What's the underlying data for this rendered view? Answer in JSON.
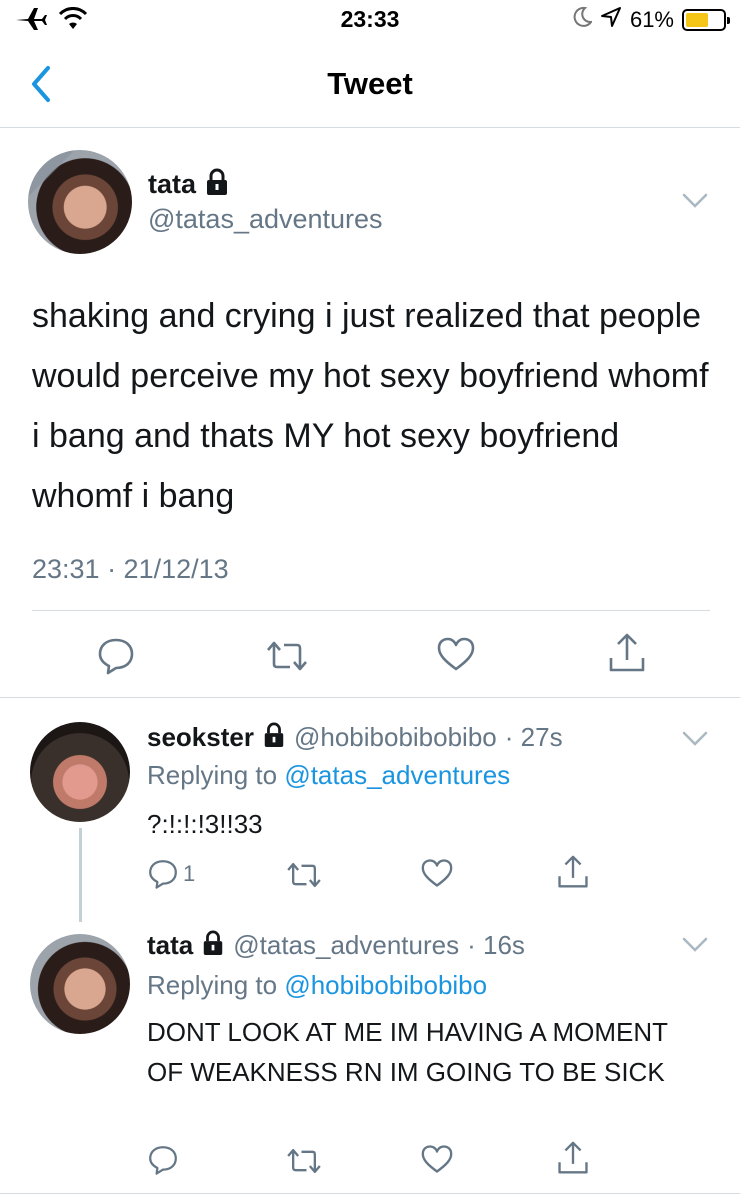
{
  "status_bar": {
    "time": "23:33",
    "battery": "61%",
    "battery_level": 0.61,
    "icons": [
      "airplane-icon",
      "wifi-icon",
      "moon-icon",
      "location-arrow-icon",
      "battery-icon"
    ]
  },
  "nav": {
    "title": "Tweet",
    "back_icon": "chevron-left-icon"
  },
  "main_tweet": {
    "name": "tata",
    "handle": "@tatas_adventures",
    "locked": true,
    "text": "shaking and crying i just realized that people would perceive my hot sexy boyfriend whomf i bang and thats MY hot sexy boyfriend whomf i bang",
    "timestamp": "23:31 · 21/12/13",
    "actions": [
      "reply-icon",
      "retweet-icon",
      "like-icon",
      "share-icon"
    ]
  },
  "replies": [
    {
      "name": "seokster",
      "handle": "@hobibobibobibo",
      "time": "· 27s",
      "locked": true,
      "replying_label": "Replying to",
      "replying_to": "@tatas_adventures",
      "text": "?:!:!:!3!!33",
      "reply_count": "1"
    },
    {
      "name": "tata",
      "handle": "@tatas_adventures",
      "time": "· 16s",
      "locked": true,
      "replying_label": "Replying to",
      "replying_to": "@hobibobibobibo",
      "text": "DONT LOOK AT ME IM HAVING A MOMENT OF WEAKNESS RN IM GOING TO BE SICK",
      "reply_count": ""
    }
  ],
  "colors": {
    "accent": "#1b95e0",
    "secondary_text": "#657786",
    "divider": "#d6dbe0",
    "battery": "#f5c518"
  }
}
